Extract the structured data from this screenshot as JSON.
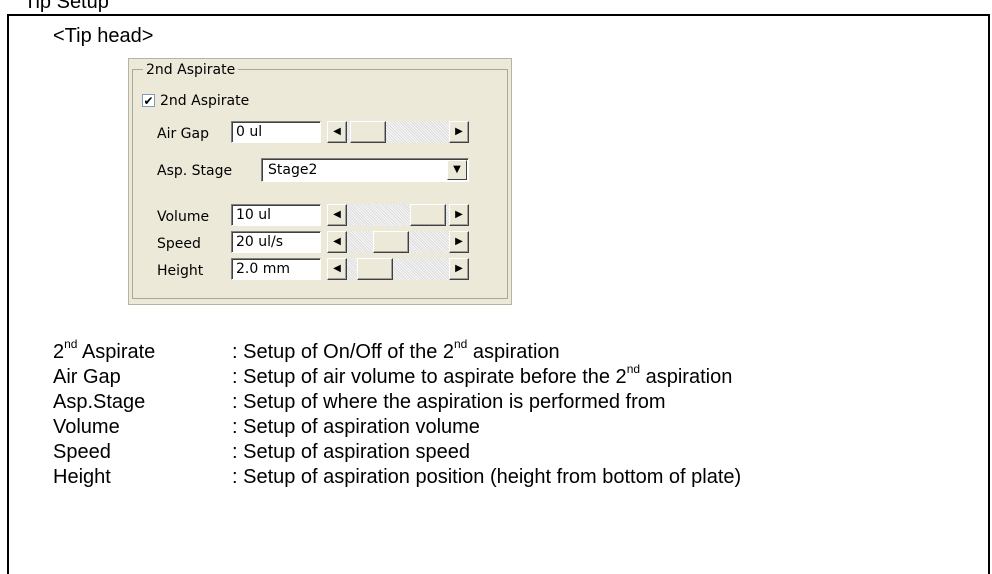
{
  "top_fragment": "Tip Setup",
  "heading": "<Tip head>",
  "panel": {
    "group_title": "2nd Aspirate",
    "checkbox": {
      "label": "2nd Aspirate",
      "checked": true
    },
    "air_gap": {
      "label": "Air Gap",
      "value": "0 ul",
      "slider_level": 0.05
    },
    "asp_stage": {
      "label": "Asp. Stage",
      "value": "Stage2"
    },
    "volume": {
      "label": "Volume",
      "value": "10 ul",
      "slider_level": 0.95
    },
    "speed": {
      "label": "Speed",
      "value": "20 ul/s",
      "slider_level": 0.4
    },
    "height": {
      "label": "Height",
      "value": "2.0 mm",
      "slider_level": 0.15
    }
  },
  "descriptions": [
    {
      "term_pre": "2",
      "term_sup": "nd",
      "term_post": " Aspirate",
      "def_pre": ": Setup of On/Off of the 2",
      "def_sup": "nd",
      "def_post": " aspiration"
    },
    {
      "term_pre": "Air Gap",
      "term_sup": "",
      "term_post": "",
      "def_pre": ": Setup of air volume to aspirate before the 2",
      "def_sup": "nd",
      "def_post": " aspiration"
    },
    {
      "term_pre": "Asp.Stage",
      "term_sup": "",
      "term_post": "",
      "def_pre": ": Setup of where the aspiration is performed from",
      "def_sup": "",
      "def_post": ""
    },
    {
      "term_pre": "Volume",
      "term_sup": "",
      "term_post": "",
      "def_pre": ": Setup of aspiration volume",
      "def_sup": "",
      "def_post": ""
    },
    {
      "term_pre": "Speed",
      "term_sup": "",
      "term_post": "",
      "def_pre": ": Setup of aspiration speed",
      "def_sup": "",
      "def_post": ""
    },
    {
      "term_pre": "Height",
      "term_sup": "",
      "term_post": "",
      "def_pre": ": Setup of aspiration position (height from bottom of plate)",
      "def_sup": "",
      "def_post": ""
    }
  ],
  "icons": {
    "check": "✔",
    "arrow_left": "◀",
    "arrow_right": "▶",
    "arrow_down": "▼"
  }
}
